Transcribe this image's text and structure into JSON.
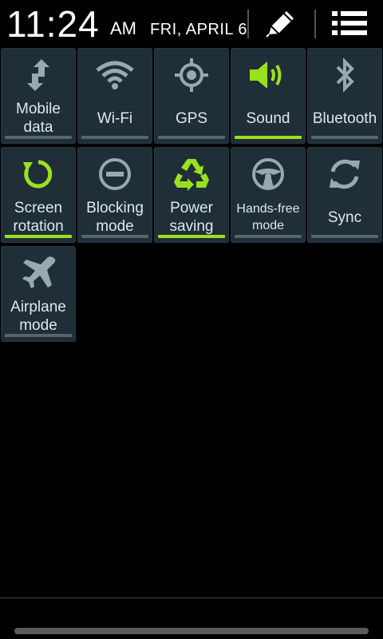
{
  "status": {
    "time": "11:24",
    "ampm": "AM",
    "date": "FRI, APRIL 6"
  },
  "header": {
    "edit_icon": "pencil-icon",
    "menu_icon": "list-menu-icon"
  },
  "colors": {
    "tile_bg": "#1f2e37",
    "active": "#9be01e",
    "inactive_icon": "#9aa8b1",
    "inactive_bar": "#55656f"
  },
  "tiles": [
    {
      "label": "Mobile\ndata",
      "icon": "mobile-data-icon",
      "active": false
    },
    {
      "label": "Wi-Fi",
      "icon": "wifi-icon",
      "active": false
    },
    {
      "label": "GPS",
      "icon": "gps-icon",
      "active": false
    },
    {
      "label": "Sound",
      "icon": "sound-icon",
      "active": true
    },
    {
      "label": "Bluetooth",
      "icon": "bluetooth-icon",
      "active": false
    },
    {
      "label": "Screen\nrotation",
      "icon": "rotation-icon",
      "active": true
    },
    {
      "label": "Blocking\nmode",
      "icon": "blocking-icon",
      "active": false
    },
    {
      "label": "Power\nsaving",
      "icon": "recycle-icon",
      "active": true
    },
    {
      "label": "Hands-free\nmode",
      "icon": "steering-wheel-icon",
      "active": false
    },
    {
      "label": "Sync",
      "icon": "sync-icon",
      "active": false
    },
    {
      "label": "Airplane\nmode",
      "icon": "airplane-icon",
      "active": false
    }
  ]
}
